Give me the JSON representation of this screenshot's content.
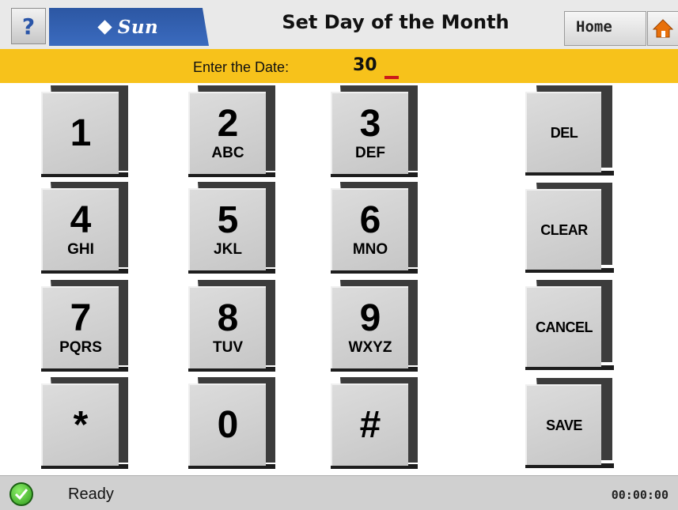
{
  "header": {
    "help_label": "?",
    "logo_text": "Sun",
    "title": "Set Day of the Month",
    "home_label": "Home"
  },
  "entry": {
    "label": "Enter the Date:",
    "value": "30"
  },
  "keypad": {
    "keys": [
      {
        "digit": "1",
        "letters": ""
      },
      {
        "digit": "2",
        "letters": "ABC"
      },
      {
        "digit": "3",
        "letters": "DEF"
      },
      {
        "digit": "4",
        "letters": "GHI"
      },
      {
        "digit": "5",
        "letters": "JKL"
      },
      {
        "digit": "6",
        "letters": "MNO"
      },
      {
        "digit": "7",
        "letters": "PQRS"
      },
      {
        "digit": "8",
        "letters": "TUV"
      },
      {
        "digit": "9",
        "letters": "WXYZ"
      },
      {
        "digit": "*",
        "letters": ""
      },
      {
        "digit": "0",
        "letters": ""
      },
      {
        "digit": "#",
        "letters": ""
      }
    ],
    "actions": {
      "del": "DEL",
      "clear": "CLEAR",
      "cancel": "CANCEL",
      "save": "SAVE"
    }
  },
  "status": {
    "text": "Ready",
    "clock": "00:00:00",
    "icon": "checkmark-icon"
  },
  "colors": {
    "entry_bar": "#f7c21b",
    "logo_blue": "#2c57a3",
    "home_icon": "#e8700a",
    "status_ok": "#3fb52a"
  }
}
